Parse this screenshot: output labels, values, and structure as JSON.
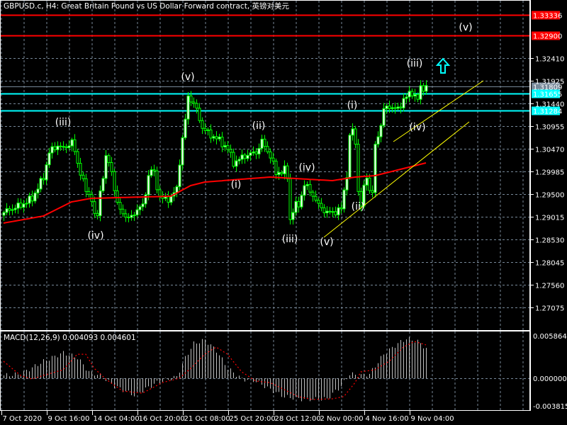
{
  "header": {
    "title": "GBPUSD.c, H4:  Great Britain Pound vs US Dollar Forward contract, 英镑对美元"
  },
  "macd_label": "MACD(12,26,9) 0.004093 0.004601",
  "colors": {
    "background": "#000000",
    "grid": "#778899",
    "candle": "#00ff00",
    "bull_body": "#ffffff",
    "bear_body": "#000000",
    "ma": "#ff0000",
    "red_level": "#ff0000",
    "cyan_level": "#00ffff",
    "current_price": "#778899",
    "trendline": "#ffff00",
    "signal": "#ff0000",
    "histogram": "#c0c0c0"
  },
  "chart_data": [
    {
      "type": "candlestick",
      "title": "GBPUSD.c, H4",
      "ylim": [
        1.26589,
        1.33654
      ],
      "bars": 150,
      "close_path": [
        [
          0,
          1.29106
        ],
        [
          2.5,
          1.29182
        ],
        [
          6,
          1.29257
        ],
        [
          10,
          1.29409
        ],
        [
          14,
          1.29864
        ],
        [
          16,
          1.30394
        ],
        [
          19,
          1.30546
        ],
        [
          21,
          1.3047
        ],
        [
          24,
          1.30622
        ],
        [
          26,
          1.30167
        ],
        [
          29,
          1.29561
        ],
        [
          31,
          1.29409
        ],
        [
          32.5,
          1.28803
        ],
        [
          34,
          1.29561
        ],
        [
          36,
          1.30243
        ],
        [
          37.5,
          1.30167
        ],
        [
          40,
          1.29257
        ],
        [
          44,
          1.28954
        ],
        [
          46,
          1.29106
        ],
        [
          49,
          1.29257
        ],
        [
          51,
          1.29864
        ],
        [
          52.5,
          1.30091
        ],
        [
          55,
          1.29409
        ],
        [
          59,
          1.29409
        ],
        [
          61,
          1.29636
        ],
        [
          62.5,
          1.3047
        ],
        [
          64,
          1.31077
        ],
        [
          65,
          1.31607
        ],
        [
          67.5,
          1.3138
        ],
        [
          70,
          1.30925
        ],
        [
          72.5,
          1.30773
        ],
        [
          75,
          1.30698
        ],
        [
          79,
          1.3047
        ],
        [
          81,
          1.30167
        ],
        [
          85,
          1.30319
        ],
        [
          89,
          1.30394
        ],
        [
          91,
          1.30622
        ],
        [
          94,
          1.30319
        ],
        [
          96,
          1.2994
        ],
        [
          99,
          1.30015
        ],
        [
          100,
          1.29864
        ],
        [
          101,
          1.28954
        ],
        [
          102.5,
          1.29257
        ],
        [
          104,
          1.29257
        ],
        [
          106,
          1.29712
        ],
        [
          109,
          1.29485
        ],
        [
          111,
          1.29257
        ],
        [
          114,
          1.29106
        ],
        [
          116,
          1.29106
        ],
        [
          119,
          1.29182
        ],
        [
          121,
          1.2994
        ],
        [
          122.5,
          1.31077
        ],
        [
          124,
          1.30546
        ],
        [
          125,
          1.29636
        ],
        [
          126,
          1.29182
        ],
        [
          127.5,
          1.2994
        ],
        [
          129,
          1.29636
        ],
        [
          130,
          1.29485
        ],
        [
          131,
          1.30546
        ],
        [
          132.5,
          1.3085
        ],
        [
          134,
          1.31304
        ],
        [
          136,
          1.3138
        ],
        [
          139,
          1.31304
        ],
        [
          141,
          1.31531
        ],
        [
          144,
          1.31683
        ],
        [
          145,
          1.31607
        ],
        [
          146,
          1.31531
        ],
        [
          147,
          1.31759
        ],
        [
          149,
          1.31804
        ]
      ],
      "moving_average": [
        [
          0,
          1.28879
        ],
        [
          14,
          1.2903
        ],
        [
          24,
          1.29333
        ],
        [
          31,
          1.29409
        ],
        [
          59,
          1.29454
        ],
        [
          66,
          1.29682
        ],
        [
          71,
          1.29758
        ],
        [
          94,
          1.29864
        ],
        [
          116,
          1.29788
        ],
        [
          124,
          1.29864
        ],
        [
          131,
          1.29894
        ],
        [
          139,
          1.30015
        ],
        [
          149,
          1.30167
        ]
      ],
      "price_ticks": [
        "1.32410",
        "1.31925",
        "1.31440",
        "1.30955",
        "1.30470",
        "1.29985",
        "1.29500",
        "1.29015",
        "1.28530",
        "1.28045",
        "1.27560",
        "1.27075"
      ],
      "levels": [
        {
          "price": "1.33336",
          "kind": "red"
        },
        {
          "price": "1.32900",
          "kind": "red"
        },
        {
          "price": "1.31809",
          "kind": "current"
        },
        {
          "price": "1.31655",
          "kind": "cyan"
        },
        {
          "price": "1.31284",
          "kind": "cyan"
        }
      ],
      "trendlines": [
        [
          [
            113,
            1.28575
          ],
          [
            164.25,
            1.31046
          ]
        ],
        [
          [
            137.5,
            1.30622
          ],
          [
            169.25,
            1.31926
          ]
        ]
      ],
      "wave_labels": [
        {
          "text": "(iii)",
          "bar": 21,
          "price": 1.31046
        },
        {
          "text": "(iv)",
          "bar": 32.5,
          "price": 1.28621
        },
        {
          "text": "(v)",
          "bar": 65,
          "price": 1.32017
        },
        {
          "text": "(i)",
          "bar": 82,
          "price": 1.29712
        },
        {
          "text": "(ii)",
          "bar": 90,
          "price": 1.3097
        },
        {
          "text": "(iii)",
          "bar": 101,
          "price": 1.28545
        },
        {
          "text": "(iv)",
          "bar": 107,
          "price": 1.30076
        },
        {
          "text": "(v)",
          "bar": 114,
          "price": 1.28484
        },
        {
          "text": "(i)",
          "bar": 123,
          "price": 1.3141
        },
        {
          "text": "(ii)",
          "bar": 125,
          "price": 1.29242
        },
        {
          "text": "(iii)",
          "bar": 145,
          "price": 1.32305
        },
        {
          "text": "(iv)",
          "bar": 146,
          "price": 1.3094
        },
        {
          "text": "(v)",
          "bar": 163,
          "price": 1.33078
        }
      ],
      "up_arrow": {
        "bar": 155,
        "price": 1.32244
      }
    },
    {
      "type": "histogram+line",
      "title": "MACD(12,26,9)",
      "ylim": [
        -0.00449,
        0.00655
      ],
      "y_ticks": [
        "0.005864",
        "0.000000",
        "-0.003815"
      ],
      "macd": [
        [
          0,
          0.00039
        ],
        [
          6,
          0.00059
        ],
        [
          14,
          0.00234
        ],
        [
          21,
          0.00352
        ],
        [
          26,
          0.00283
        ],
        [
          30,
          0.00088
        ],
        [
          34,
          0.00039
        ],
        [
          39,
          -0.00107
        ],
        [
          46,
          -0.00234
        ],
        [
          54,
          -0.00059
        ],
        [
          61,
          0.0002
        ],
        [
          64,
          0.00283
        ],
        [
          67,
          0.00479
        ],
        [
          71,
          0.00528
        ],
        [
          75,
          0.00381
        ],
        [
          79,
          0.00137
        ],
        [
          84,
          -0.0001
        ],
        [
          89,
          -0.00039
        ],
        [
          94,
          -0.00156
        ],
        [
          99,
          -0.00254
        ],
        [
          106,
          -0.00293
        ],
        [
          114,
          -0.00283
        ],
        [
          119,
          -0.00107
        ],
        [
          122,
          0.00059
        ],
        [
          126,
          0.00039
        ],
        [
          129,
          0.00059
        ],
        [
          134,
          0.00332
        ],
        [
          139,
          0.00479
        ],
        [
          142,
          0.00547
        ],
        [
          146,
          0.00508
        ],
        [
          149,
          0.004093
        ]
      ],
      "signal": [
        [
          0,
          0.00234
        ],
        [
          6,
          0.00039
        ],
        [
          10,
          -0.0001
        ],
        [
          14,
          0.00039
        ],
        [
          21,
          0.00117
        ],
        [
          26,
          0.00332
        ],
        [
          29,
          0.00332
        ],
        [
          32,
          0.00137
        ],
        [
          36,
          -0.0001
        ],
        [
          42,
          -0.00176
        ],
        [
          49,
          -0.00205
        ],
        [
          56,
          -0.00059
        ],
        [
          62,
          0
        ],
        [
          66,
          0.00137
        ],
        [
          71,
          0.00332
        ],
        [
          75,
          0.0043
        ],
        [
          79,
          0.00332
        ],
        [
          84,
          0.00088
        ],
        [
          89,
          -0.00039
        ],
        [
          94,
          -0.00059
        ],
        [
          99,
          -0.00156
        ],
        [
          104,
          -0.00254
        ],
        [
          109,
          -0.00293
        ],
        [
          116,
          -0.00283
        ],
        [
          120,
          -0.00254
        ],
        [
          124,
          -0.00059
        ],
        [
          126,
          0.00088
        ],
        [
          131,
          0.00117
        ],
        [
          136,
          0.00234
        ],
        [
          141,
          0.0043
        ],
        [
          145,
          0.00508
        ],
        [
          149,
          0.004601
        ]
      ]
    }
  ],
  "time_axis": [
    "7 Oct 2020",
    "9 Oct 16:00",
    "14 Oct 04:00",
    "16 Oct 20:00",
    "21 Oct 08:00",
    "25 Oct 20:00",
    "28 Oct 12:00",
    "2 Nov 00:00",
    "4 Nov 16:00",
    "9 Nov 04:00"
  ]
}
